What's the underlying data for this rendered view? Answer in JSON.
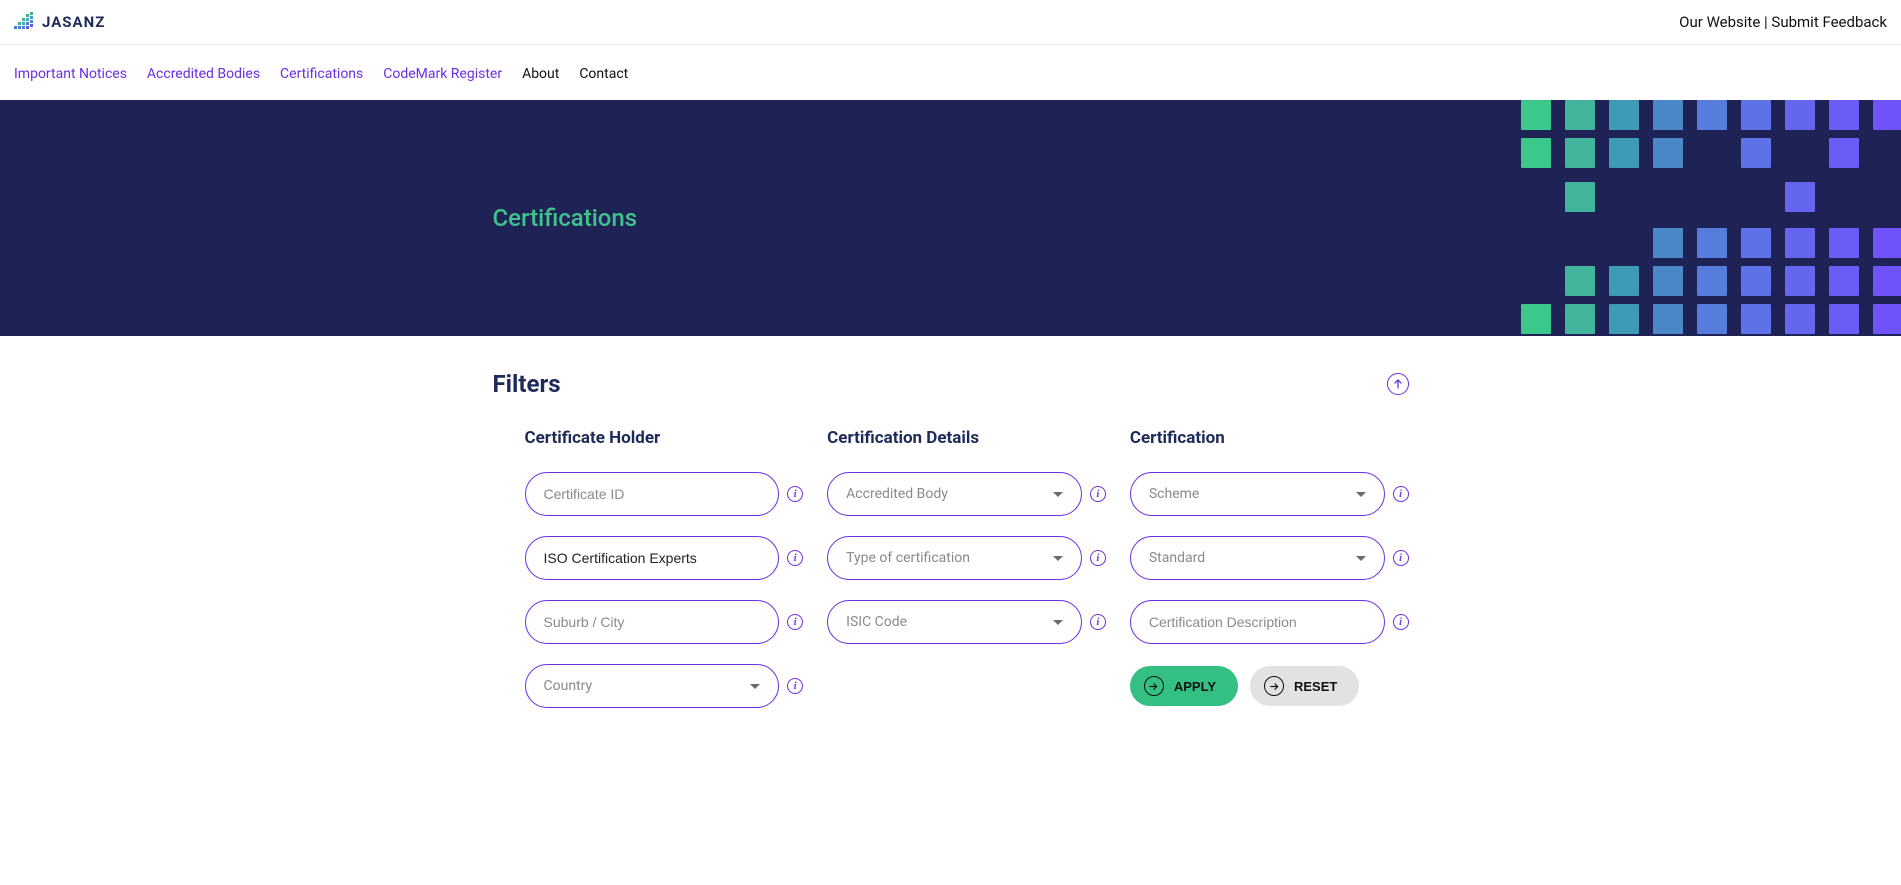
{
  "header": {
    "brand": "JASANZ",
    "our_website": "Our Website",
    "separator": "|",
    "submit_feedback": "Submit Feedback"
  },
  "nav": {
    "notices": "Important Notices",
    "accredited_bodies": "Accredited Bodies",
    "certifications": "Certifications",
    "codemark": "CodeMark Register",
    "about": "About",
    "contact": "Contact"
  },
  "hero": {
    "title": "Certifications"
  },
  "filters": {
    "heading": "Filters",
    "col1_title": "Certificate Holder",
    "col2_title": "Certification Details",
    "col3_title": "Certification",
    "certificate_id_placeholder": "Certificate ID",
    "certificate_id_value": "",
    "org_value": "ISO Certification Experts",
    "suburb_placeholder": "Suburb / City",
    "suburb_value": "",
    "country_placeholder": "Country",
    "accredited_body_placeholder": "Accredited Body",
    "type_placeholder": "Type of certification",
    "isic_placeholder": "ISIC Code",
    "scheme_placeholder": "Scheme",
    "standard_placeholder": "Standard",
    "desc_placeholder": "Certification Description",
    "desc_value": "",
    "apply_label": "APPLY",
    "reset_label": "RESET",
    "info_glyph": "i"
  }
}
